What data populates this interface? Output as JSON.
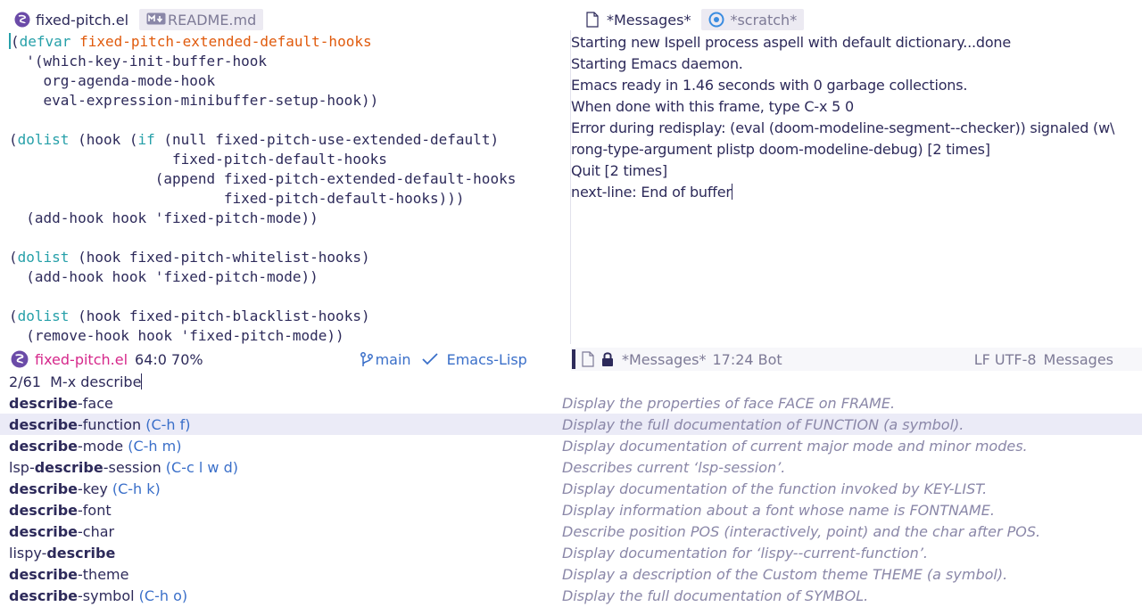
{
  "left_window": {
    "tabs": [
      {
        "label": "fixed-pitch.el",
        "icon": "emacs-icon",
        "active": true
      },
      {
        "label": "README.md",
        "icon": "markdown-icon",
        "active": false
      }
    ]
  },
  "right_window": {
    "tabs": [
      {
        "label": "*Messages*",
        "icon": "file-icon",
        "active": true
      },
      {
        "label": "*scratch*",
        "icon": "scratch-icon",
        "active": false
      }
    ],
    "messages": [
      "Starting new Ispell process aspell with default dictionary...done",
      "Starting Emacs daemon.",
      "Emacs ready in 1.46 seconds with 0 garbage collections.",
      "When done with this frame, type C-x 5 0",
      "Error during redisplay: (eval (doom-modeline-segment--checker)) signaled (w\\",
      "rong-type-argument plistp doom-modeline-debug) [2 times]",
      "Quit [2 times]",
      "next-line: End of buffer"
    ]
  },
  "modeline_left": {
    "buffer": "fixed-pitch.el",
    "position": "64:0 70%",
    "branch": "main",
    "mode": "Emacs-Lisp"
  },
  "modeline_right": {
    "buffer": "*Messages*",
    "position": "17:24 Bot",
    "encoding": "LF UTF-8",
    "mode": "Messages"
  },
  "minibuffer": {
    "count": "2/61",
    "prompt": "M-x",
    "input": "describe"
  },
  "candidates": [
    {
      "prefix": "",
      "match": "describe",
      "suffix": "-face",
      "key": "",
      "doc": "Display the properties of face FACE on FRAME.",
      "selected": false
    },
    {
      "prefix": "",
      "match": "describe",
      "suffix": "-function",
      "key": "(C-h f)",
      "doc": "Display the full documentation of FUNCTION (a symbol).",
      "selected": true
    },
    {
      "prefix": "",
      "match": "describe",
      "suffix": "-mode",
      "key": "(C-h m)",
      "doc": "Display documentation of current major mode and minor modes.",
      "selected": false
    },
    {
      "prefix": "lsp-",
      "match": "describe",
      "suffix": "-session",
      "key": "(C-c l w d)",
      "doc": "Describes current ‘lsp-session’.",
      "selected": false
    },
    {
      "prefix": "",
      "match": "describe",
      "suffix": "-key",
      "key": "(C-h k)",
      "doc": "Display documentation of the function invoked by KEY-LIST.",
      "selected": false
    },
    {
      "prefix": "",
      "match": "describe",
      "suffix": "-font",
      "key": "",
      "doc": "Display information about a font whose name is FONTNAME.",
      "selected": false
    },
    {
      "prefix": "",
      "match": "describe",
      "suffix": "-char",
      "key": "",
      "doc": "Describe position POS (interactively, point) and the char after POS.",
      "selected": false
    },
    {
      "prefix": "lispy-",
      "match": "describe",
      "suffix": "",
      "key": "",
      "doc": "Display documentation for ‘lispy--current-function’.",
      "selected": false
    },
    {
      "prefix": "",
      "match": "describe",
      "suffix": "-theme",
      "key": "",
      "doc": "Display a description of the Custom theme THEME (a symbol).",
      "selected": false
    },
    {
      "prefix": "",
      "match": "describe",
      "suffix": "-symbol",
      "key": "(C-h o)",
      "doc": "Display the full documentation of SYMBOL.",
      "selected": false
    }
  ],
  "code": {
    "defvar_kw": "defvar",
    "defvar_name": "fixed-pitch-extended-default-hooks",
    "line2": "  '(which-key-init-buffer-hook",
    "line3": "    org-agenda-mode-hook",
    "line4": "    eval-expression-minibuffer-setup-hook))",
    "dolist_kw": "dolist",
    "if_kw": "if",
    "b1_l1_a": " (hook (",
    "b1_l1_b": " (null fixed-pitch-use-extended-default)",
    "b1_l2": "                   fixed-pitch-default-hooks",
    "b1_l3": "                 (append fixed-pitch-extended-default-hooks",
    "b1_l4": "                         fixed-pitch-default-hooks)))",
    "b1_l5": "  (add-hook hook 'fixed-pitch-mode))",
    "b2_l1": " (hook fixed-pitch-whitelist-hooks)",
    "b2_l2": "  (add-hook hook 'fixed-pitch-mode))",
    "b3_l1": " (hook fixed-pitch-blacklist-hooks)",
    "b3_l2": "  (remove-hook hook 'fixed-pitch-mode))"
  },
  "colors": {
    "keyword": "#26a0a9",
    "defvar_name": "#e05a0c",
    "buffer_name": "#d6288b",
    "key_binding": "#3a6fc9",
    "selection": "#ebebf7"
  }
}
